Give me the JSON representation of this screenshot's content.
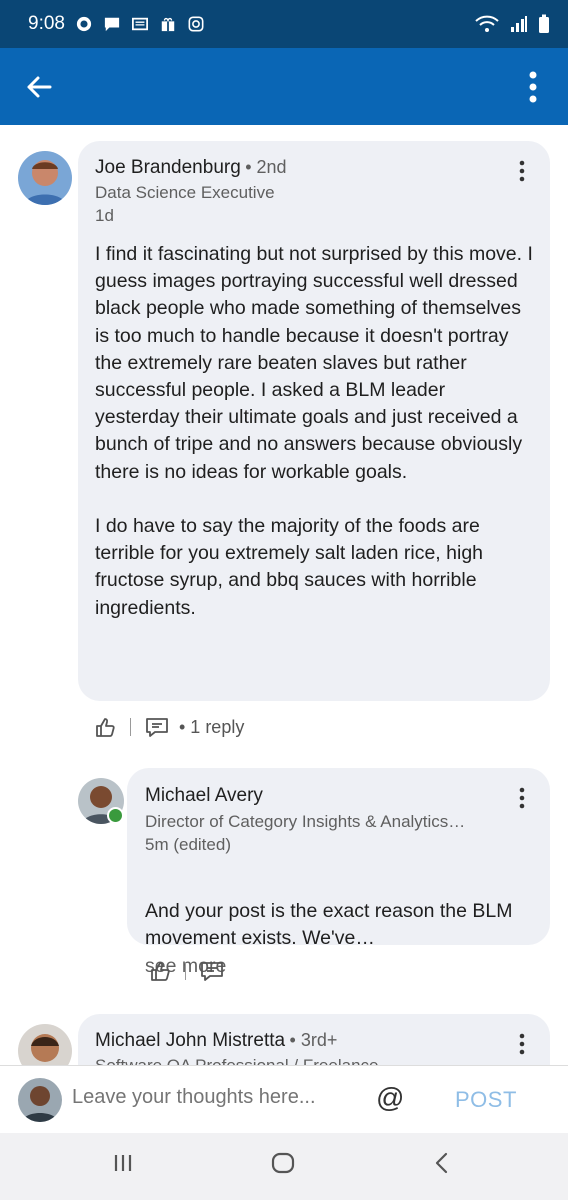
{
  "status_bar": {
    "time": "9:08",
    "left_icons": [
      "whatsapp-icon",
      "message-icon",
      "news-icon",
      "gift-icon",
      "instagram-icon"
    ],
    "right_icons": [
      "wifi-icon",
      "signal-icon",
      "battery-icon"
    ]
  },
  "app_bar": {
    "back_icon": "arrow-left-icon",
    "menu_icon": "more-vertical-icon",
    "color": "#0a66b5"
  },
  "comments": [
    {
      "name": "Joe Brandenburg",
      "degree": "• 2nd",
      "headline": "Data Science Executive",
      "timestamp": "1d",
      "body": "I find it fascinating but not surprised by this move. I guess images portraying successful well dressed black people who made something of themselves is too much to handle because it doesn't portray the extremely rare beaten slaves but rather successful people. I asked a BLM leader yesterday their ultimate goals and just received a bunch of tripe and no answers because obviously there is no ideas for workable goals.\n\n I do have to say the majority of the foods are terrible for you extremely salt laden rice, high fructose syrup, and bbq sauces with horrible ingredients.",
      "reply_count": "• 1 reply"
    },
    {
      "name": "Michael Avery",
      "headline": "Director of Category Insights & Analytics…",
      "timestamp": "5m (edited)",
      "body": "And your post is the exact reason the BLM movement exists. We've…",
      "see_more": "see more"
    },
    {
      "name": "Michael John Mistretta",
      "degree": "• 3rd+",
      "headline": "Software QA Professional / Freelance"
    }
  ],
  "composer": {
    "placeholder": "Leave your thoughts here...",
    "at_label": "@",
    "post_label": "POST"
  },
  "nav_bar": {
    "icons": [
      "recent-apps-icon",
      "home-icon",
      "back-icon"
    ]
  }
}
